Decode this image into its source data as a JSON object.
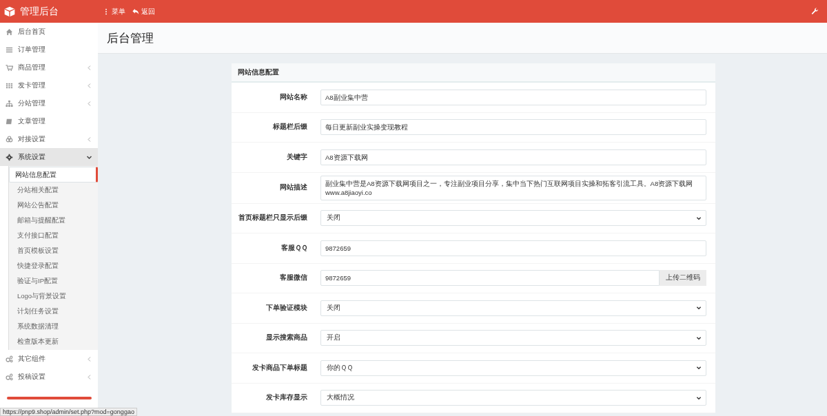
{
  "topbar": {
    "title": "管理后台",
    "actions": [
      {
        "kind": "menu",
        "label": "菜单"
      },
      {
        "kind": "back",
        "label": "返回"
      }
    ]
  },
  "sidebar": {
    "items": [
      {
        "label": "后台首页",
        "has_submenu": false,
        "expanded": false
      },
      {
        "label": "订单管理",
        "has_submenu": false,
        "expanded": false
      },
      {
        "label": "商品管理",
        "has_submenu": true,
        "expanded": false
      },
      {
        "label": "发卡管理",
        "has_submenu": true,
        "expanded": false
      },
      {
        "label": "分站管理",
        "has_submenu": true,
        "expanded": false
      },
      {
        "label": "文章管理",
        "has_submenu": false,
        "expanded": false
      },
      {
        "label": "对接设置",
        "has_submenu": true,
        "expanded": false
      },
      {
        "label": "系统设置",
        "has_submenu": true,
        "expanded": true,
        "children": [
          {
            "label": "网站信息配置",
            "selected": true
          },
          {
            "label": "分站相关配置",
            "selected": false
          },
          {
            "label": "网站公告配置",
            "selected": false
          },
          {
            "label": "邮箱与提醒配置",
            "selected": false
          },
          {
            "label": "支付接口配置",
            "selected": false
          },
          {
            "label": "首页模板设置",
            "selected": false
          },
          {
            "label": "快捷登录配置",
            "selected": false
          },
          {
            "label": "验证与IP配置",
            "selected": false
          },
          {
            "label": "Logo与背景设置",
            "selected": false
          },
          {
            "label": "计划任务设置",
            "selected": false
          },
          {
            "label": "系统数据清理",
            "selected": false
          },
          {
            "label": "检查版本更新",
            "selected": false
          }
        ]
      },
      {
        "label": "其它组件",
        "has_submenu": true,
        "expanded": false
      },
      {
        "label": "投稿设置",
        "has_submenu": true,
        "expanded": false
      }
    ]
  },
  "page_title": "后台管理",
  "panel": {
    "title": "网站信息配置",
    "fields": [
      {
        "kind": "input",
        "label": "网站名称",
        "value": "A8副业集中营"
      },
      {
        "kind": "input",
        "label": "标题栏后缀",
        "value": "每日更新副业实操变现教程"
      },
      {
        "kind": "input",
        "label": "关键字",
        "value": "A8资源下载网"
      },
      {
        "kind": "input",
        "label": "网站描述",
        "value": "副业集中营是A8资源下载网项目之一，专注副业项目分享，集中当下热门互联网项目实操和拓客引流工具。A8资源下载网www.a8jiaoyi.co"
      },
      {
        "kind": "select",
        "label": "首页标题栏只显示后缀",
        "value": "关闭"
      },
      {
        "kind": "input",
        "label": "客服ＱＱ",
        "value": "9872659"
      },
      {
        "kind": "input_button",
        "label": "客服微信",
        "value": "9872659",
        "button": "上传二维码"
      },
      {
        "kind": "select",
        "label": "下单验证模块",
        "value": "关闭"
      },
      {
        "kind": "select",
        "label": "显示搜索商品",
        "value": "开启"
      },
      {
        "kind": "select",
        "label": "发卡商品下单标题",
        "value": "你的ＱＱ"
      },
      {
        "kind": "select",
        "label": "发卡库存显示",
        "value": "大概情况"
      }
    ]
  },
  "status_bar": {
    "url": "https://pnp9.shop/admin/set.php?mod=gonggao"
  }
}
